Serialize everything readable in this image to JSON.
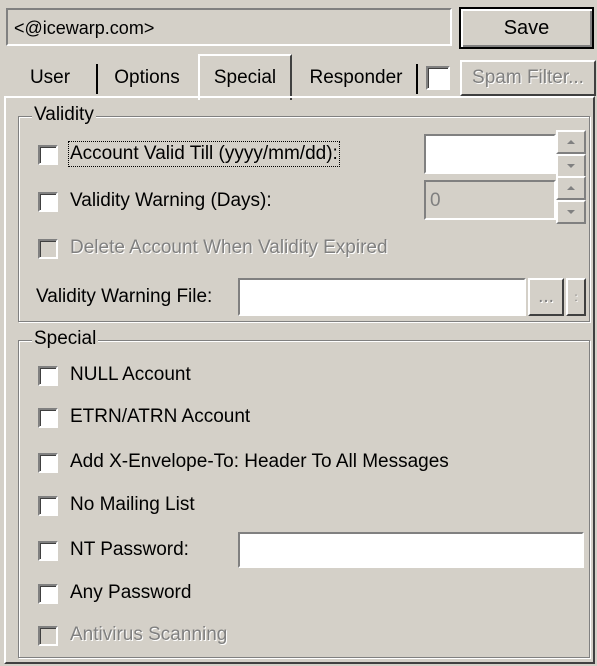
{
  "header": {
    "email_value": "<@icewarp.com>",
    "save_label": "Save"
  },
  "tabs": [
    {
      "label": "User"
    },
    {
      "label": "Options"
    },
    {
      "label": "Special"
    },
    {
      "label": "Responder"
    }
  ],
  "spam_filter_label": "Spam Filter...",
  "validity": {
    "group_label": "Validity",
    "account_valid_till_label": "Account Valid Till (yyyy/mm/dd):",
    "account_valid_till_value": "",
    "validity_warning_label": "Validity Warning (Days):",
    "validity_warning_value": "0",
    "delete_account_label": "Delete Account When Validity Expired",
    "warning_file_label": "Validity Warning File:",
    "warning_file_value": "",
    "browse_label": "..."
  },
  "special": {
    "group_label": "Special",
    "null_account_label": "NULL Account",
    "etrn_label": "ETRN/ATRN Account",
    "x_envelope_label": "Add X-Envelope-To: Header To All Messages",
    "no_mailing_list_label": "No Mailing List",
    "nt_password_label": "NT Password:",
    "nt_password_value": "",
    "any_password_label": "Any Password",
    "antivirus_label": "Antivirus Scanning"
  }
}
